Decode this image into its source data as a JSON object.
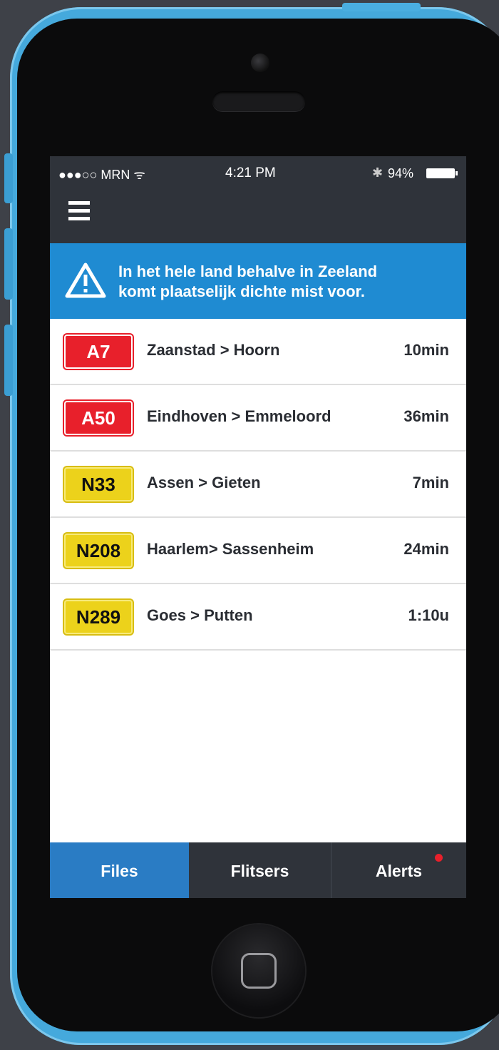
{
  "status_bar": {
    "carrier": "●●●○○ MRN ᯤ",
    "time": "4:21 PM",
    "bluetooth": "✱",
    "battery_percent": "94%"
  },
  "alert": {
    "message_line1": "In het hele land behalve in Zeeland",
    "message_line2": "komt plaatselijk dichte mist voor."
  },
  "routes": [
    {
      "road": "A7",
      "type": "highway",
      "route": "Zaanstad > Hoorn",
      "time": "10min"
    },
    {
      "road": "A50",
      "type": "highway",
      "route": "Eindhoven > Emmeloord",
      "time": "36min"
    },
    {
      "road": "N33",
      "type": "provincial",
      "route": "Assen > Gieten",
      "time": "7min"
    },
    {
      "road": "N208",
      "type": "provincial",
      "route": "Haarlem> Sassenheim",
      "time": "24min"
    },
    {
      "road": "N289",
      "type": "provincial",
      "route": "Goes > Putten",
      "time": "1:10u"
    }
  ],
  "tabs": {
    "files": "Files",
    "flitsers": "Flitsers",
    "alerts": "Alerts",
    "active": "files",
    "alerts_has_notification": true
  },
  "colors": {
    "accent_blue": "#2a7cc4",
    "banner_blue": "#1f8bd2",
    "highway_red": "#e8202b",
    "provincial_yellow": "#ecd21b",
    "dark_bar": "#2f333a",
    "phone_body": "#45a9dc"
  },
  "icons": [
    "menu-icon",
    "warning-icon",
    "bluetooth-icon",
    "battery-icon",
    "wifi-icon",
    "home-button-icon"
  ]
}
